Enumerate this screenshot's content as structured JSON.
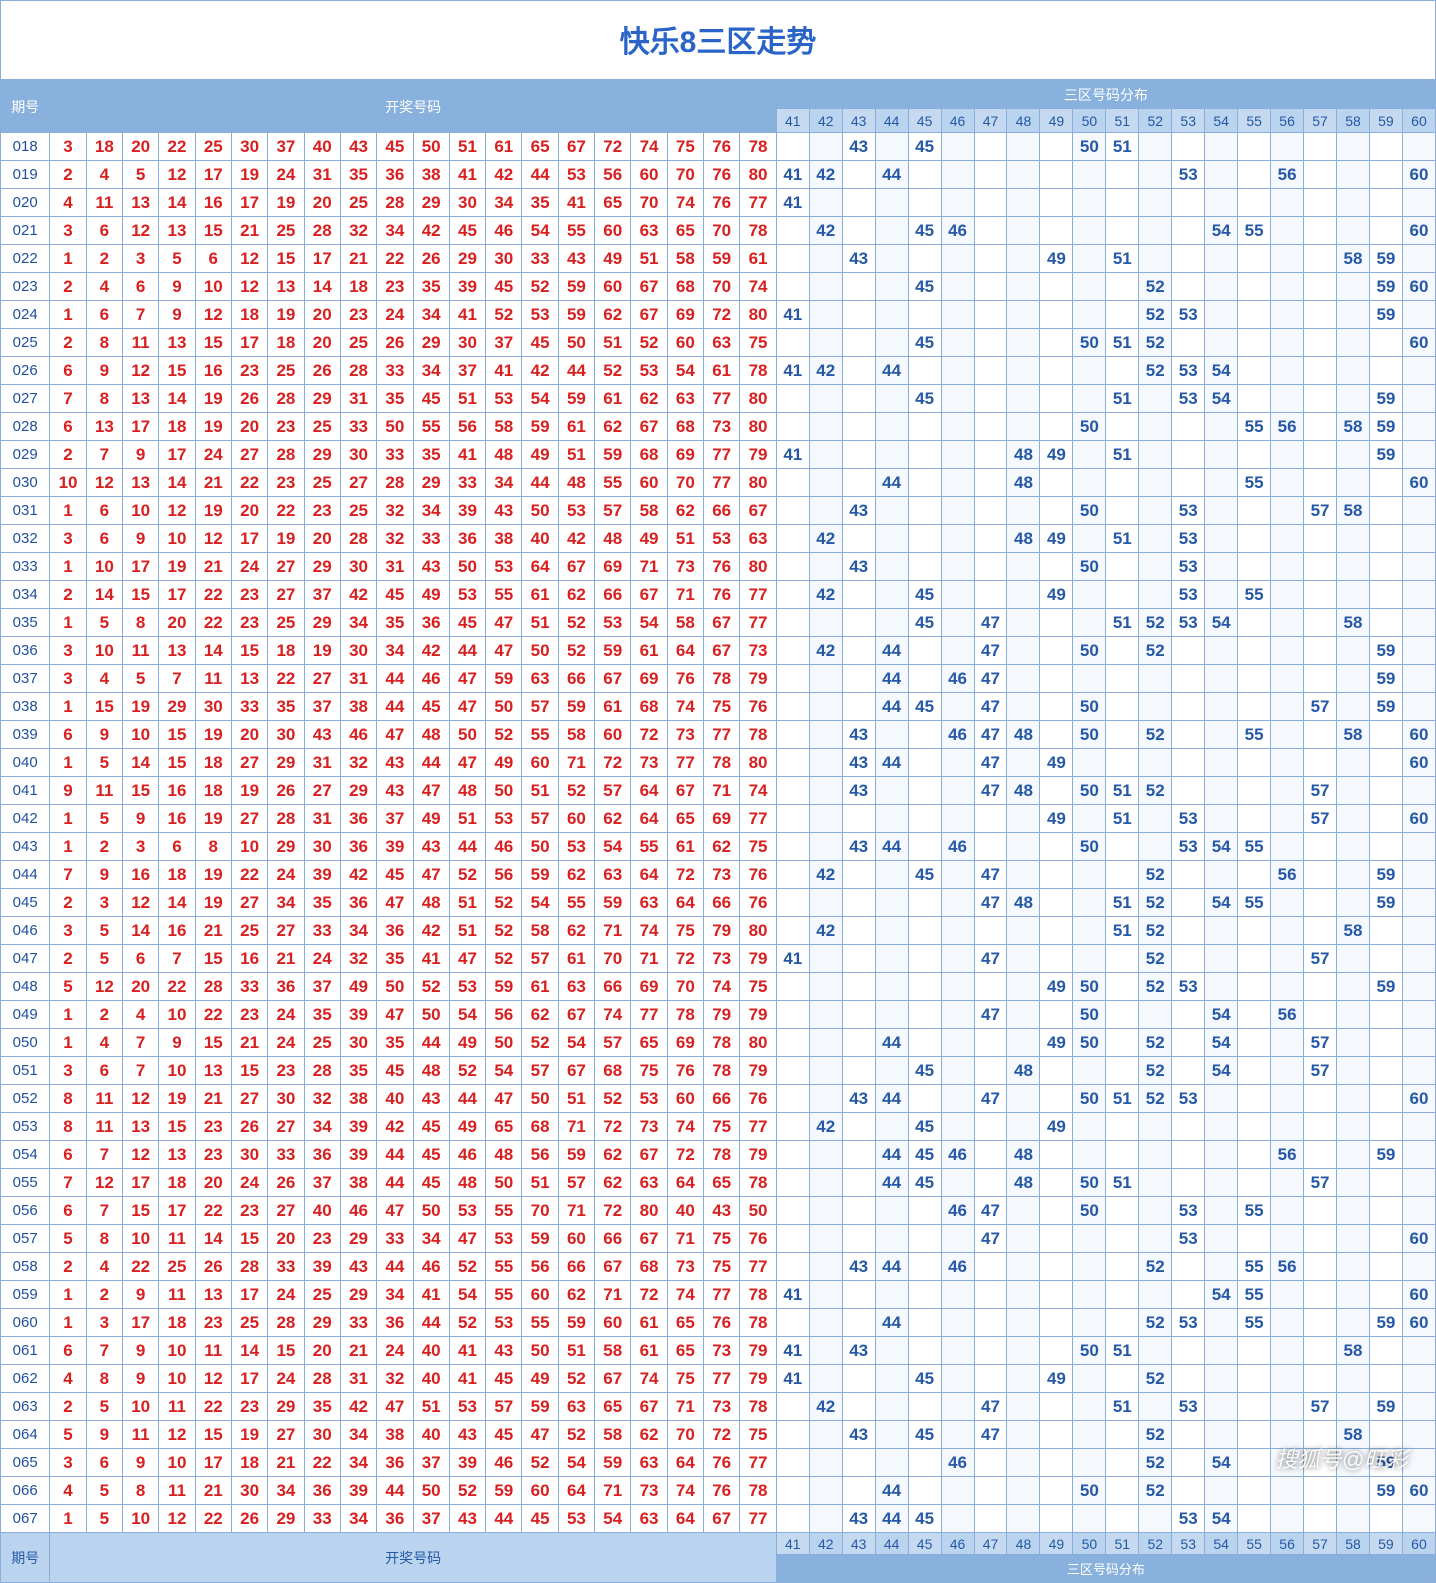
{
  "title": "快乐8三区走势",
  "headers": {
    "period": "期号",
    "drawn": "开奖号码",
    "dist_group": "三区号码分布"
  },
  "dist_columns": [
    41,
    42,
    43,
    44,
    45,
    46,
    47,
    48,
    49,
    50,
    51,
    52,
    53,
    54,
    55,
    56,
    57,
    58,
    59,
    60
  ],
  "watermark": "搜狐号@旺彩",
  "rows": [
    {
      "p": "018",
      "d": [
        3,
        18,
        20,
        22,
        25,
        30,
        37,
        40,
        43,
        45,
        50,
        51,
        61,
        65,
        67,
        72,
        74,
        75,
        76,
        78
      ],
      "z": [
        43,
        45,
        50,
        51
      ]
    },
    {
      "p": "019",
      "d": [
        2,
        4,
        5,
        12,
        17,
        19,
        24,
        31,
        35,
        36,
        38,
        41,
        42,
        44,
        53,
        56,
        60,
        70,
        76,
        80
      ],
      "z": [
        41,
        42,
        44,
        53,
        56,
        60
      ]
    },
    {
      "p": "020",
      "d": [
        4,
        11,
        13,
        14,
        16,
        17,
        19,
        20,
        25,
        28,
        29,
        30,
        34,
        35,
        41,
        65,
        70,
        74,
        76,
        77
      ],
      "z": [
        41
      ]
    },
    {
      "p": "021",
      "d": [
        3,
        6,
        12,
        13,
        15,
        21,
        25,
        28,
        32,
        34,
        42,
        45,
        46,
        54,
        55,
        60,
        63,
        65,
        70,
        78
      ],
      "z": [
        42,
        45,
        46,
        54,
        55,
        60
      ]
    },
    {
      "p": "022",
      "d": [
        1,
        2,
        3,
        5,
        6,
        12,
        15,
        17,
        21,
        22,
        26,
        29,
        30,
        33,
        43,
        49,
        51,
        58,
        59,
        61
      ],
      "z": [
        43,
        49,
        51,
        58,
        59
      ]
    },
    {
      "p": "023",
      "d": [
        2,
        4,
        6,
        9,
        10,
        12,
        13,
        14,
        18,
        23,
        35,
        39,
        45,
        52,
        59,
        60,
        67,
        68,
        70,
        74
      ],
      "z": [
        45,
        52,
        59,
        60
      ]
    },
    {
      "p": "024",
      "d": [
        1,
        6,
        7,
        9,
        12,
        18,
        19,
        20,
        23,
        24,
        34,
        41,
        52,
        53,
        59,
        62,
        67,
        69,
        72,
        80
      ],
      "z": [
        41,
        52,
        53,
        59
      ]
    },
    {
      "p": "025",
      "d": [
        2,
        8,
        11,
        13,
        15,
        17,
        18,
        20,
        25,
        26,
        29,
        30,
        37,
        45,
        50,
        51,
        52,
        60,
        63,
        75
      ],
      "z": [
        45,
        50,
        51,
        52,
        60
      ]
    },
    {
      "p": "026",
      "d": [
        6,
        9,
        12,
        15,
        16,
        23,
        25,
        26,
        28,
        33,
        34,
        37,
        41,
        42,
        44,
        52,
        53,
        54,
        61,
        78
      ],
      "z": [
        41,
        42,
        44,
        52,
        53,
        54
      ]
    },
    {
      "p": "027",
      "d": [
        7,
        8,
        13,
        14,
        19,
        26,
        28,
        29,
        31,
        35,
        45,
        51,
        53,
        54,
        59,
        61,
        62,
        63,
        77,
        80
      ],
      "z": [
        45,
        51,
        53,
        54,
        59
      ]
    },
    {
      "p": "028",
      "d": [
        6,
        13,
        17,
        18,
        19,
        20,
        23,
        25,
        33,
        50,
        55,
        56,
        58,
        59,
        61,
        62,
        67,
        68,
        73,
        80
      ],
      "z": [
        50,
        55,
        56,
        58,
        59
      ]
    },
    {
      "p": "029",
      "d": [
        2,
        7,
        9,
        17,
        24,
        27,
        28,
        29,
        30,
        33,
        35,
        41,
        48,
        49,
        51,
        59,
        68,
        69,
        77,
        79
      ],
      "z": [
        41,
        48,
        49,
        51,
        59
      ]
    },
    {
      "p": "030",
      "d": [
        10,
        12,
        13,
        14,
        21,
        22,
        23,
        25,
        27,
        28,
        29,
        33,
        34,
        44,
        48,
        55,
        60,
        70,
        77,
        80
      ],
      "z": [
        44,
        48,
        55,
        60
      ]
    },
    {
      "p": "031",
      "d": [
        1,
        6,
        10,
        12,
        19,
        20,
        22,
        23,
        25,
        32,
        34,
        39,
        43,
        50,
        53,
        57,
        58,
        62,
        66,
        67
      ],
      "z": [
        43,
        50,
        53,
        57,
        58
      ]
    },
    {
      "p": "032",
      "d": [
        3,
        6,
        9,
        10,
        12,
        17,
        19,
        20,
        28,
        32,
        33,
        36,
        38,
        40,
        42,
        48,
        49,
        51,
        53,
        63
      ],
      "z": [
        42,
        48,
        49,
        51,
        53
      ]
    },
    {
      "p": "033",
      "d": [
        1,
        10,
        17,
        19,
        21,
        24,
        27,
        29,
        30,
        31,
        43,
        50,
        53,
        64,
        67,
        69,
        71,
        73,
        76,
        80
      ],
      "z": [
        43,
        50,
        53
      ]
    },
    {
      "p": "034",
      "d": [
        2,
        14,
        15,
        17,
        22,
        23,
        27,
        37,
        42,
        45,
        49,
        53,
        55,
        61,
        62,
        66,
        67,
        71,
        76,
        77
      ],
      "z": [
        42,
        45,
        49,
        53,
        55
      ]
    },
    {
      "p": "035",
      "d": [
        1,
        5,
        8,
        20,
        22,
        23,
        25,
        29,
        34,
        35,
        36,
        45,
        47,
        51,
        52,
        53,
        54,
        58,
        67,
        77
      ],
      "z": [
        45,
        47,
        51,
        52,
        53,
        54,
        58
      ]
    },
    {
      "p": "036",
      "d": [
        3,
        10,
        11,
        13,
        14,
        15,
        18,
        19,
        30,
        34,
        42,
        44,
        47,
        50,
        52,
        59,
        61,
        64,
        67,
        73
      ],
      "z": [
        42,
        44,
        47,
        50,
        52,
        59
      ]
    },
    {
      "p": "037",
      "d": [
        3,
        4,
        5,
        7,
        11,
        13,
        22,
        27,
        31,
        44,
        46,
        47,
        59,
        63,
        66,
        67,
        69,
        76,
        78,
        79
      ],
      "z": [
        44,
        46,
        47,
        59
      ]
    },
    {
      "p": "038",
      "d": [
        1,
        15,
        19,
        29,
        30,
        33,
        35,
        37,
        38,
        44,
        45,
        47,
        50,
        57,
        59,
        61,
        68,
        74,
        75,
        76
      ],
      "z": [
        44,
        45,
        47,
        50,
        57,
        59
      ]
    },
    {
      "p": "039",
      "d": [
        6,
        9,
        10,
        15,
        19,
        20,
        30,
        43,
        46,
        47,
        48,
        50,
        52,
        55,
        58,
        60,
        72,
        73,
        77,
        78
      ],
      "z": [
        43,
        46,
        47,
        48,
        50,
        52,
        55,
        58,
        60
      ]
    },
    {
      "p": "040",
      "d": [
        1,
        5,
        14,
        15,
        18,
        27,
        29,
        31,
        32,
        43,
        44,
        47,
        49,
        60,
        71,
        72,
        73,
        77,
        78,
        80
      ],
      "z": [
        43,
        44,
        47,
        49,
        60
      ]
    },
    {
      "p": "041",
      "d": [
        9,
        11,
        15,
        16,
        18,
        19,
        26,
        27,
        29,
        43,
        47,
        48,
        50,
        51,
        52,
        57,
        64,
        67,
        71,
        74
      ],
      "z": [
        43,
        47,
        48,
        50,
        51,
        52,
        57
      ]
    },
    {
      "p": "042",
      "d": [
        1,
        5,
        9,
        16,
        19,
        27,
        28,
        31,
        36,
        37,
        49,
        51,
        53,
        57,
        60,
        62,
        64,
        65,
        69,
        77
      ],
      "z": [
        49,
        51,
        53,
        57,
        60
      ]
    },
    {
      "p": "043",
      "d": [
        1,
        2,
        3,
        6,
        8,
        10,
        29,
        30,
        36,
        39,
        43,
        44,
        46,
        50,
        53,
        54,
        55,
        61,
        62,
        75
      ],
      "z": [
        43,
        44,
        46,
        50,
        53,
        54,
        55
      ]
    },
    {
      "p": "044",
      "d": [
        7,
        9,
        16,
        18,
        19,
        22,
        24,
        39,
        42,
        45,
        47,
        52,
        56,
        59,
        62,
        63,
        64,
        72,
        73,
        76
      ],
      "z": [
        42,
        45,
        47,
        52,
        56,
        59
      ]
    },
    {
      "p": "045",
      "d": [
        2,
        3,
        12,
        14,
        19,
        27,
        34,
        35,
        36,
        47,
        48,
        51,
        52,
        54,
        55,
        59,
        63,
        64,
        66,
        76
      ],
      "z": [
        47,
        48,
        51,
        52,
        54,
        55,
        59
      ]
    },
    {
      "p": "046",
      "d": [
        3,
        5,
        14,
        16,
        21,
        25,
        27,
        33,
        34,
        36,
        42,
        51,
        52,
        58,
        62,
        71,
        74,
        75,
        79,
        80
      ],
      "z": [
        42,
        51,
        52,
        58
      ]
    },
    {
      "p": "047",
      "d": [
        2,
        5,
        6,
        7,
        15,
        16,
        21,
        24,
        32,
        35,
        41,
        47,
        52,
        57,
        61,
        70,
        71,
        72,
        73,
        79
      ],
      "z": [
        41,
        47,
        52,
        57
      ]
    },
    {
      "p": "048",
      "d": [
        5,
        12,
        20,
        22,
        28,
        33,
        36,
        37,
        49,
        50,
        52,
        53,
        59,
        61,
        63,
        66,
        69,
        70,
        74,
        75
      ],
      "z": [
        49,
        50,
        52,
        53,
        59
      ]
    },
    {
      "p": "049",
      "d": [
        1,
        2,
        4,
        10,
        22,
        23,
        24,
        35,
        39,
        47,
        50,
        54,
        56,
        62,
        67,
        74,
        77,
        78,
        79,
        79
      ],
      "z": [
        47,
        50,
        54,
        56
      ]
    },
    {
      "p": "050",
      "d": [
        1,
        4,
        7,
        9,
        15,
        21,
        24,
        25,
        30,
        35,
        44,
        49,
        50,
        52,
        54,
        57,
        65,
        69,
        78,
        80
      ],
      "z": [
        44,
        49,
        50,
        52,
        54,
        57
      ]
    },
    {
      "p": "051",
      "d": [
        3,
        6,
        7,
        10,
        13,
        15,
        23,
        28,
        35,
        45,
        48,
        52,
        54,
        57,
        67,
        68,
        75,
        76,
        78,
        79
      ],
      "z": [
        45,
        48,
        52,
        54,
        57
      ]
    },
    {
      "p": "052",
      "d": [
        8,
        11,
        12,
        19,
        21,
        27,
        30,
        32,
        38,
        40,
        43,
        44,
        47,
        50,
        51,
        52,
        53,
        60,
        66,
        76
      ],
      "z": [
        43,
        44,
        47,
        50,
        51,
        52,
        53,
        60
      ]
    },
    {
      "p": "053",
      "d": [
        8,
        11,
        13,
        15,
        23,
        26,
        27,
        34,
        39,
        42,
        45,
        49,
        65,
        68,
        71,
        72,
        73,
        74,
        75,
        77
      ],
      "z": [
        42,
        45,
        49
      ]
    },
    {
      "p": "054",
      "d": [
        6,
        7,
        12,
        13,
        23,
        30,
        33,
        36,
        39,
        44,
        45,
        46,
        48,
        56,
        59,
        62,
        67,
        72,
        78,
        79
      ],
      "z": [
        44,
        45,
        46,
        48,
        56,
        59
      ]
    },
    {
      "p": "055",
      "d": [
        7,
        12,
        17,
        18,
        20,
        24,
        26,
        37,
        38,
        44,
        45,
        48,
        50,
        51,
        57,
        62,
        63,
        64,
        65,
        78
      ],
      "z": [
        44,
        45,
        48,
        50,
        51,
        57
      ]
    },
    {
      "p": "056",
      "d": [
        6,
        7,
        15,
        17,
        22,
        23,
        27,
        40,
        46,
        47,
        50,
        53,
        55,
        70,
        71,
        72,
        80,
        40,
        43,
        50
      ],
      "z": [
        46,
        47,
        50,
        53,
        55
      ]
    },
    {
      "p": "057",
      "d": [
        5,
        8,
        10,
        11,
        14,
        15,
        20,
        23,
        29,
        33,
        34,
        47,
        53,
        59,
        60,
        66,
        67,
        71,
        75,
        76
      ],
      "z": [
        47,
        53,
        60
      ]
    },
    {
      "p": "058",
      "d": [
        2,
        4,
        22,
        25,
        26,
        28,
        33,
        39,
        43,
        44,
        46,
        52,
        55,
        56,
        66,
        67,
        68,
        73,
        75,
        77
      ],
      "z": [
        43,
        44,
        46,
        52,
        55,
        56
      ]
    },
    {
      "p": "059",
      "d": [
        1,
        2,
        9,
        11,
        13,
        17,
        24,
        25,
        29,
        34,
        41,
        54,
        55,
        60,
        62,
        71,
        72,
        74,
        77,
        78
      ],
      "z": [
        41,
        54,
        55,
        60
      ]
    },
    {
      "p": "060",
      "d": [
        1,
        3,
        17,
        18,
        23,
        25,
        28,
        29,
        33,
        36,
        44,
        52,
        53,
        55,
        59,
        60,
        61,
        65,
        76,
        78
      ],
      "z": [
        44,
        52,
        53,
        55,
        59,
        60
      ]
    },
    {
      "p": "061",
      "d": [
        6,
        7,
        9,
        10,
        11,
        14,
        15,
        20,
        21,
        24,
        40,
        41,
        43,
        50,
        51,
        58,
        61,
        65,
        73,
        79
      ],
      "z": [
        41,
        43,
        50,
        51,
        58
      ]
    },
    {
      "p": "062",
      "d": [
        4,
        8,
        9,
        10,
        12,
        17,
        24,
        28,
        31,
        32,
        40,
        41,
        45,
        49,
        52,
        67,
        74,
        75,
        77,
        79
      ],
      "z": [
        41,
        45,
        49,
        52
      ]
    },
    {
      "p": "063",
      "d": [
        2,
        5,
        10,
        11,
        22,
        23,
        29,
        35,
        42,
        47,
        51,
        53,
        57,
        59,
        63,
        65,
        67,
        71,
        73,
        78
      ],
      "z": [
        42,
        47,
        51,
        53,
        57,
        59
      ]
    },
    {
      "p": "064",
      "d": [
        5,
        9,
        11,
        12,
        15,
        19,
        27,
        30,
        34,
        38,
        40,
        43,
        45,
        47,
        52,
        58,
        62,
        70,
        72,
        75
      ],
      "z": [
        43,
        45,
        47,
        52,
        58
      ]
    },
    {
      "p": "065",
      "d": [
        3,
        6,
        9,
        10,
        17,
        18,
        21,
        22,
        34,
        36,
        37,
        39,
        46,
        52,
        54,
        59,
        63,
        64,
        76,
        77
      ],
      "z": [
        46,
        52,
        54,
        59
      ]
    },
    {
      "p": "066",
      "d": [
        4,
        5,
        8,
        11,
        21,
        30,
        34,
        36,
        39,
        44,
        50,
        52,
        59,
        60,
        64,
        71,
        73,
        74,
        76,
        78
      ],
      "z": [
        44,
        50,
        52,
        59,
        60
      ]
    },
    {
      "p": "067",
      "d": [
        1,
        5,
        10,
        12,
        22,
        26,
        29,
        33,
        34,
        36,
        37,
        43,
        44,
        45,
        53,
        54,
        63,
        64,
        67,
        77
      ],
      "z": [
        43,
        44,
        45,
        53,
        54
      ]
    }
  ]
}
